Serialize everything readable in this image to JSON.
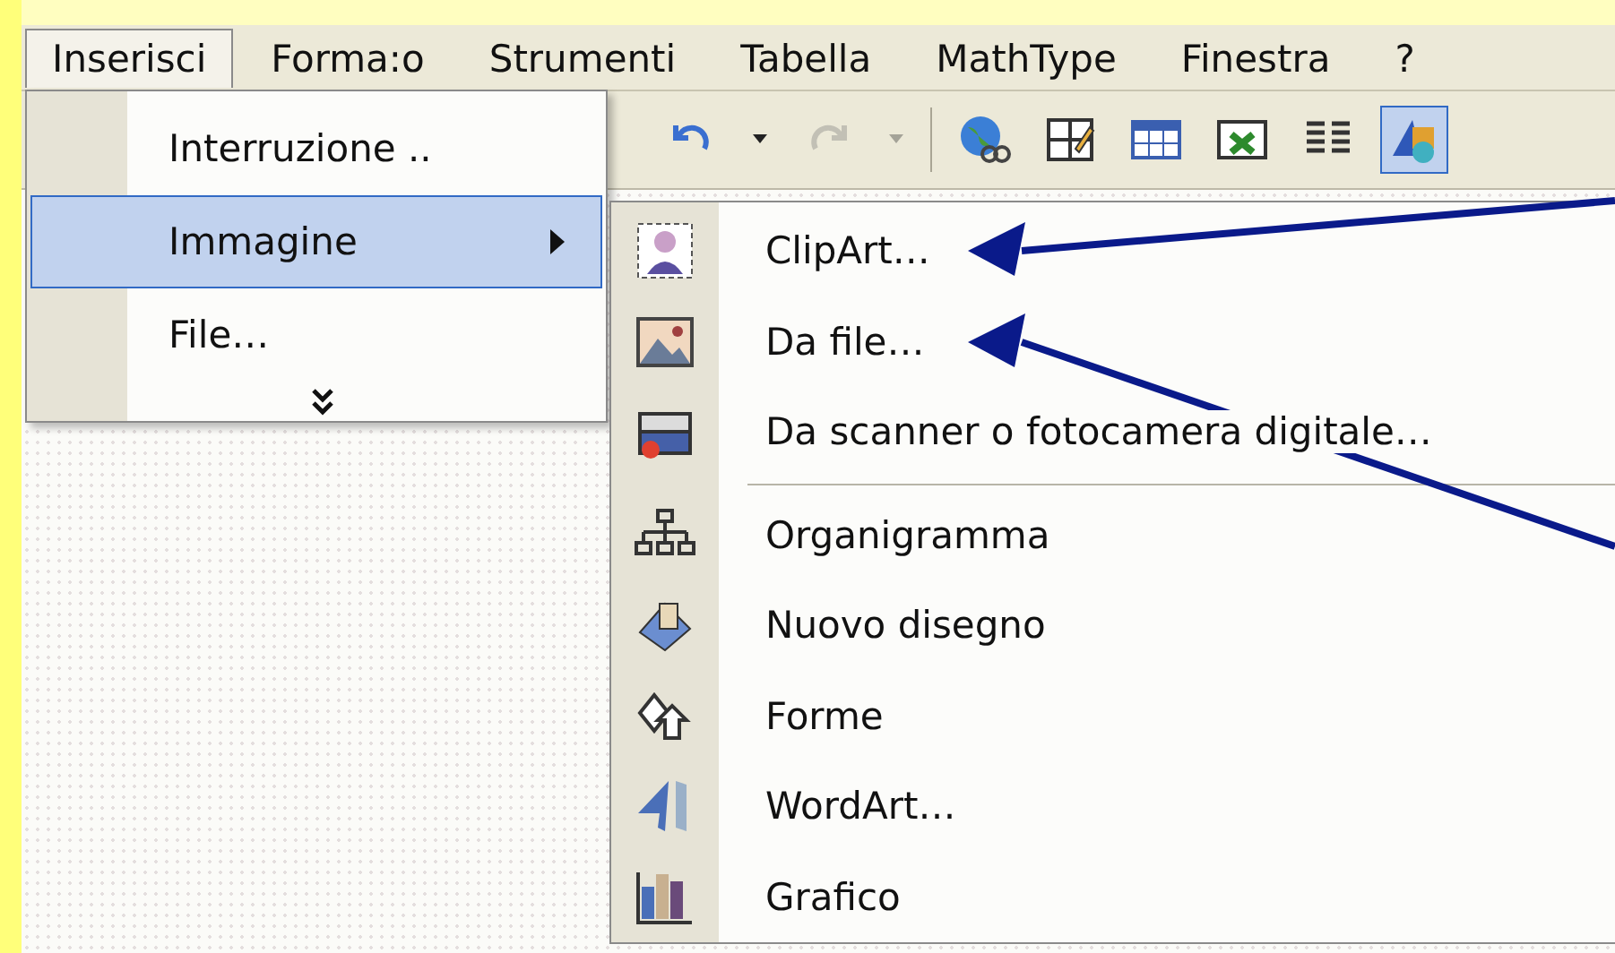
{
  "menubar": [
    {
      "label": "Inserisci",
      "selected": true
    },
    {
      "label": "Forma:o",
      "selected": false
    },
    {
      "label": "Strumenti",
      "selected": false
    },
    {
      "label": "Tabella",
      "selected": false
    },
    {
      "label": "MathType",
      "selected": false
    },
    {
      "label": "Finestra",
      "selected": false
    },
    {
      "label": "?",
      "selected": false
    }
  ],
  "toolbar": [
    {
      "tools": [
        {
          "kind": "undo",
          "disabled": false,
          "pressed": false
        },
        {
          "kind": "caret",
          "disabled": false,
          "pressed": false
        },
        {
          "kind": "redo",
          "disabled": true,
          "pressed": false
        },
        {
          "kind": "caret",
          "disabled": true,
          "pressed": false
        }
      ]
    },
    {
      "tools": [
        {
          "kind": "globe",
          "disabled": false,
          "pressed": false
        },
        {
          "kind": "table-pen",
          "disabled": false,
          "pressed": false
        },
        {
          "kind": "table",
          "disabled": false,
          "pressed": false
        },
        {
          "kind": "sheet",
          "disabled": false,
          "pressed": false
        },
        {
          "kind": "columns",
          "disabled": false,
          "pressed": false
        },
        {
          "kind": "shapes",
          "disabled": false,
          "pressed": true
        }
      ]
    }
  ],
  "menu": {
    "items": [
      {
        "label": "Interruzione ..",
        "selected": false,
        "submenu": false
      },
      {
        "label": "Immagine",
        "selected": true,
        "submenu": true
      },
      {
        "label": "File…",
        "selected": false,
        "submenu": false
      }
    ]
  },
  "submenu": {
    "items": [
      {
        "kind": "clipart",
        "label": "ClipArt…",
        "pointer": true
      },
      {
        "kind": "picture",
        "label": "Da file…",
        "pointer": true
      },
      {
        "kind": "scanner",
        "label": "Da scanner o fotocamera digitale…",
        "pointer": false
      },
      {
        "kind": "separator"
      },
      {
        "kind": "orgchart",
        "label": "Organigramma",
        "pointer": false
      },
      {
        "kind": "drawing",
        "label": "Nuovo disegno",
        "pointer": false
      },
      {
        "kind": "shapes",
        "label": "Forme",
        "pointer": false
      },
      {
        "kind": "wordart",
        "label": "WordArt…",
        "pointer": false
      },
      {
        "kind": "chart",
        "label": "Grafico",
        "pointer": false
      }
    ]
  }
}
